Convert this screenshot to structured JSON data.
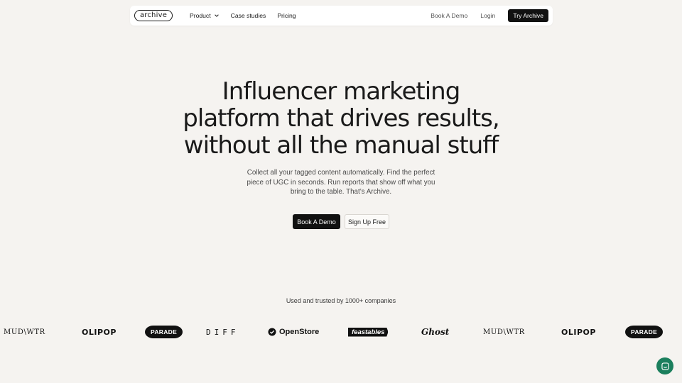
{
  "nav": {
    "logo": "archive",
    "links": [
      {
        "label": "Product"
      },
      {
        "label": "Case studies"
      },
      {
        "label": "Pricing"
      }
    ],
    "book_demo": "Book A Demo",
    "login": "Login",
    "try": "Try Archive"
  },
  "hero": {
    "title_lines": [
      "Influencer marketing",
      "platform that drives results,",
      "without all the manual stuff"
    ],
    "subtitle": "Collect all your tagged content automatically. Find the perfect piece of UGC in seconds. Run reports that show off what you bring to the table. That’s Archive.",
    "cta_primary": "Book A Demo",
    "cta_secondary": "Sign Up Free"
  },
  "trusted": {
    "text": "Used and trusted by 1000+ companies",
    "logos": [
      "MUD\\WTR",
      "OLIPOP",
      "PARADE",
      "DIFF",
      "OpenStore",
      "feastables",
      "Ghost",
      "MUD\\WTR",
      "OLIPOP",
      "PARADE"
    ]
  },
  "colors": {
    "background": "#f5f3f0",
    "primary": "#111111",
    "chat": "#1b7f5d"
  },
  "icons": {
    "product_dropdown": "chevron-down-icon",
    "chat": "chat-icon",
    "openstore": "openstore-logo-icon"
  }
}
